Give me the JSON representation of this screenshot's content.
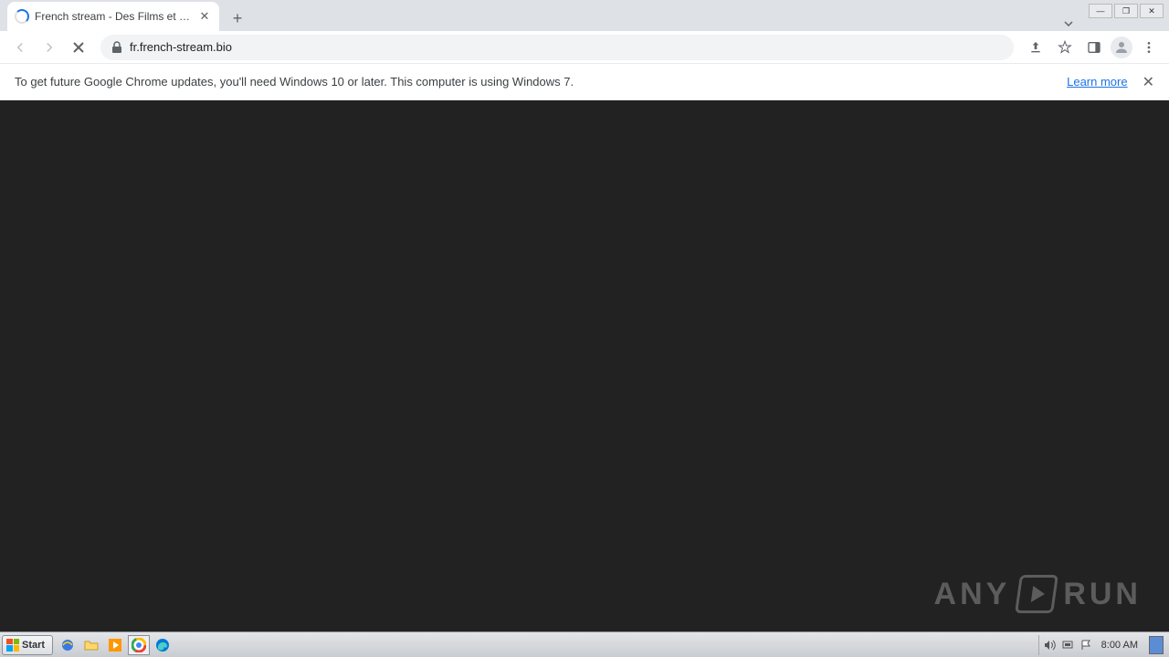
{
  "tab": {
    "title": "French stream - Des Films et Séries"
  },
  "toolbar": {
    "url": "fr.french-stream.bio"
  },
  "infobar": {
    "text": "To get future Google Chrome updates, you'll need Windows 10 or later. This computer is using Windows 7.",
    "link": "Learn more"
  },
  "watermark": {
    "left": "ANY",
    "right": "RUN"
  },
  "taskbar": {
    "start": "Start",
    "clock": "8:00 AM"
  }
}
